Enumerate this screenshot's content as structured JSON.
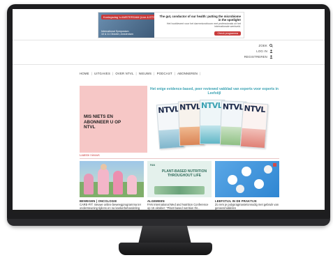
{
  "ad": {
    "pill": "Koningsdag 's AMSTERDAM (Live & ETS)",
    "left_text": "International Symposium\n10 & 11 Oktober, Amsterdam",
    "headline": "The gut, conductor of our health: putting the microbiome in the spotlight!",
    "body": "Het hoofdevent voor het darmmicrobioom met professionals uit het internationale werkveld.",
    "cta": "Check programma"
  },
  "header": {
    "zoek": "ZOEK",
    "login": "LOG IN",
    "registreren": "REGISTREREN"
  },
  "nav": {
    "items": [
      "HOME",
      "UITGAVES",
      "OVER NTVL",
      "NIEUWS",
      "PODCAST",
      "ABONNEREN"
    ]
  },
  "promo": {
    "left_title": "MIS NIETS EN ABONNEER U OP NTVL",
    "tagline": "Het enige evidence-based, peer reviewed vakblad van experts voor experts in Leefstijl",
    "magazine_logo": "NTVL"
  },
  "section": {
    "title": "Laatste nieuws",
    "cards": [
      {
        "category": "BEWEGEN | ONCOLOGIE",
        "title": "CARE-FIT: nieuwe online beweegprogramma ter ondersteuning tijdens en na kankerbehandeling"
      },
      {
        "category": "ALGEMEEN",
        "title": "FAN International Med and Nutrition Conference op 15 oktober: \"Plant-based nutrition thr..."
      },
      {
        "category": "LEEFSTIJL IN DE PRAKTIJK",
        "title": "Zo rem je polypragmasie/onnodig met gebruik van geneesmiddelen"
      }
    ],
    "card2_banner": "PLANT-BASED NUTRITION THROUGHOUT LIFE"
  },
  "icons": [
    "search-icon",
    "user-icon"
  ],
  "colors": {
    "accent": "#d14b4b",
    "teal": "#3aa2b3",
    "pink": "#f6c7c6"
  }
}
